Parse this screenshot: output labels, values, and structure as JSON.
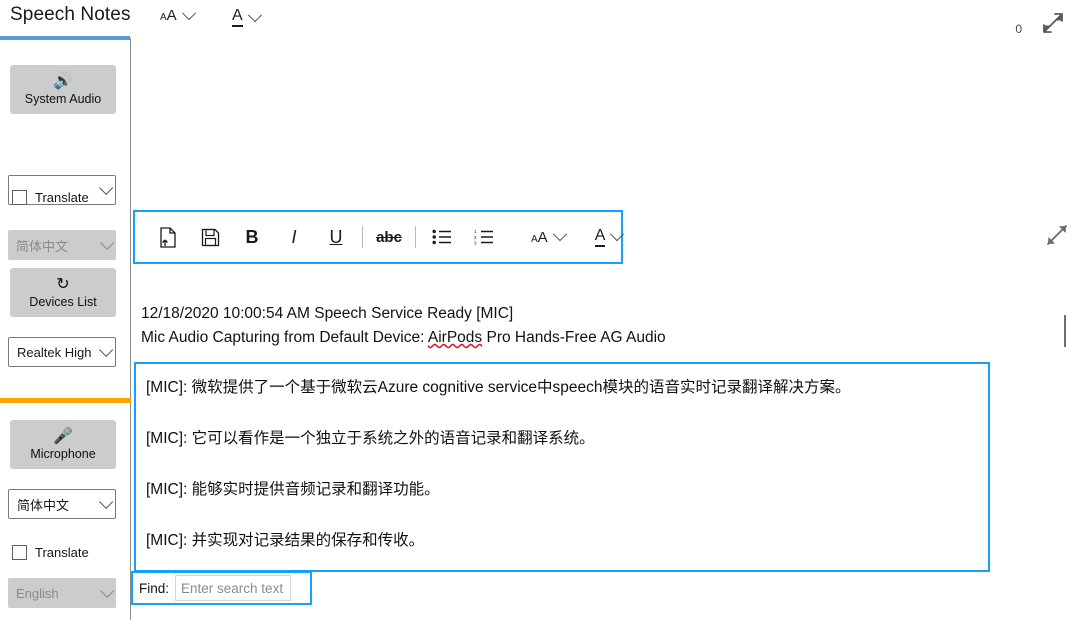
{
  "app": {
    "title": "Speech Notes"
  },
  "header": {
    "font_size_tool": {
      "label": "AA",
      "icon": "font-size-icon"
    },
    "font_color_tool": {
      "label": "A",
      "icon": "font-color-icon"
    },
    "counter": "0",
    "expand_icon": "expand-diagonal-icon"
  },
  "sidebar": {
    "system_audio_button": {
      "label": "System Audio",
      "icon": "speaker-icon"
    },
    "system_audio_language": {
      "value": "",
      "placeholder": ""
    },
    "system_audio_translate": {
      "label": "Translate",
      "checked": false
    },
    "system_audio_translate_language": {
      "value": "简体中文",
      "disabled": true
    },
    "devices_list_button": {
      "label": "Devices List",
      "icon": "refresh-icon"
    },
    "device_select": {
      "value": "Realtek High"
    },
    "microphone_button": {
      "label": "Microphone",
      "icon": "microphone-icon"
    },
    "microphone_language": {
      "value": "简体中文"
    },
    "microphone_translate": {
      "label": "Translate",
      "checked": false
    },
    "microphone_translate_language": {
      "value": "English",
      "disabled": true
    }
  },
  "format_toolbar": {
    "buttons": [
      {
        "name": "new-file-button",
        "icon": "new-file-icon",
        "label": ""
      },
      {
        "name": "save-button",
        "icon": "save-disk-icon",
        "label": ""
      },
      {
        "name": "bold-button",
        "icon": "bold-icon",
        "label": "B"
      },
      {
        "name": "italic-button",
        "icon": "italic-icon",
        "label": "I"
      },
      {
        "name": "underline-button",
        "icon": "underline-icon",
        "label": "U"
      },
      {
        "name": "strikethrough-button",
        "icon": "strikethrough-icon",
        "label": "abc"
      },
      {
        "name": "bullet-list-button",
        "icon": "bullet-list-icon",
        "label": ""
      },
      {
        "name": "numbered-list-button",
        "icon": "numbered-list-icon",
        "label": ""
      }
    ],
    "font_size_tool": {
      "label": "AA",
      "icon": "font-size-icon"
    },
    "font_color_tool": {
      "label": "A",
      "icon": "font-color-icon"
    },
    "expand_icon": "expand-diagonal-icon"
  },
  "status": {
    "line1": "12/18/2020 10:00:54 AM Speech Service Ready [MIC]",
    "line2_prefix": "Mic Audio Capturing from Default Device: ",
    "line2_device": "AirPods",
    "line2_suffix": " Pro Hands-Free AG Audio"
  },
  "transcript": {
    "lines": [
      "[MIC]: 微软提供了一个基于微软云Azure cognitive service中speech模块的语音实时记录翻译解决方案。",
      "[MIC]: 它可以看作是一个独立于系统之外的语音记录和翻译系统。",
      "[MIC]: 能够实时提供音频记录和翻译功能。",
      "[MIC]: 并实现对记录结果的保存和传收。"
    ]
  },
  "find": {
    "label": "Find:",
    "value": "",
    "placeholder": "Enter search text"
  },
  "colors": {
    "accent_blue": "#1a9ffb",
    "title_underline_blue": "#5b9bd5",
    "accent_orange": "#ffa400",
    "button_gray": "#cccccc"
  }
}
